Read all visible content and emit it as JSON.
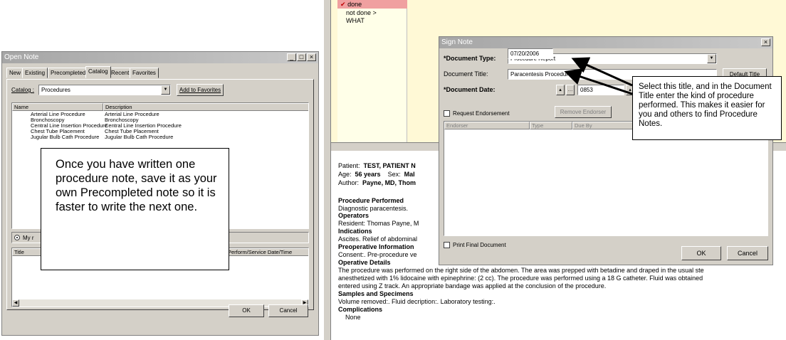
{
  "open_note": {
    "title": "Open Note",
    "tabs": [
      "New",
      "Existing",
      "Precompleted",
      "Catalog",
      "Recent",
      "Favorites"
    ],
    "active_tab": "Catalog",
    "catalog_label": "Catalog :",
    "catalog_value": "Procedures",
    "add_favorites": "Add to Favorites",
    "columns": [
      "Name",
      "Description"
    ],
    "rows": [
      {
        "name": "Arterial Line Procedure",
        "desc": "Arterial Line Procedure"
      },
      {
        "name": "Bronchoscopy",
        "desc": "Bronchoscopy"
      },
      {
        "name": "Central Line Insertion Procedure",
        "desc": "Central Line Insertion Procedure"
      },
      {
        "name": "Chest Tube Placement",
        "desc": "Chest Tube Placement"
      },
      {
        "name": "Jugular Bulb Cath Procedure",
        "desc": "Jugular Bulb Cath Procedure"
      }
    ],
    "radio_label": "My r",
    "lower_columns": [
      "Title",
      "Perform/Service Date/Time"
    ],
    "ok": "OK",
    "cancel": "Cancel"
  },
  "callout_left": "Once you have written one procedure note, save it as your own Precompleted note so it is faster to write the next one.",
  "status_list": {
    "item1": "done",
    "item2": "not done >",
    "item3": "WHAT"
  },
  "sign_note": {
    "title": "Sign Note",
    "doc_type_label": "*Document Type:",
    "doc_type_value": "Procedure Report",
    "doc_title_label": "Document Title:",
    "doc_title_value": "Paracentesis Procedure",
    "default_title": "Default Title",
    "doc_date_label": "*Document Date:",
    "doc_date_value": "07/20/2006",
    "doc_time_value": "0853",
    "request_endorsement": "Request Endorsement",
    "remove_endorser": "Remove Endorser",
    "endorser_cols": [
      "Endorser",
      "Type",
      "Due By"
    ],
    "print_final": "Print Final Document",
    "ok": "OK",
    "cancel": "Cancel"
  },
  "callout_right": "Select this title, and in the Document Title enter the kind of procedure performed.  This makes it easier for you and others to find Procedure Notes.",
  "note": {
    "patient_label": "Patient:",
    "patient_value": "TEST, PATIENT N",
    "age_label": "Age:",
    "age_value": "56 years",
    "sex_label": "Sex:",
    "sex_value": "Mal",
    "author_label": "Author:",
    "author_value": "Payne, MD, Thom",
    "procedure_performed_h": "Procedure Performed",
    "procedure_performed": "Diagnostic paracentesis.",
    "operators_h": "Operators",
    "operators": "Resident: Thomas Payne, M",
    "indications_h": "Indications",
    "indications": "Ascites.  Relief of abdominal",
    "preop_h": "Preoperative Information",
    "preop": "Consent:.  Pre-procedure ve",
    "operative_h": "Operative Details",
    "operative_1": "The procedure was performed on the right side of the abdomen.  The area was prepped with betadine and draped in the usual ste",
    "operative_2": "anesthetized with 1% lidocaine with epinephrine: (2 cc).  The procedure was performed using a 18 G catheter.  Fluid was obtained",
    "operative_3": "entered using Z track.  An appropriate bandage was applied at the conclusion of the procedure.",
    "samples_h": "Samples and Specimens",
    "samples": "Volume removed:.  Fluid decription:.  Laboratory testing:.",
    "complications_h": "Complications",
    "complications": "None"
  }
}
